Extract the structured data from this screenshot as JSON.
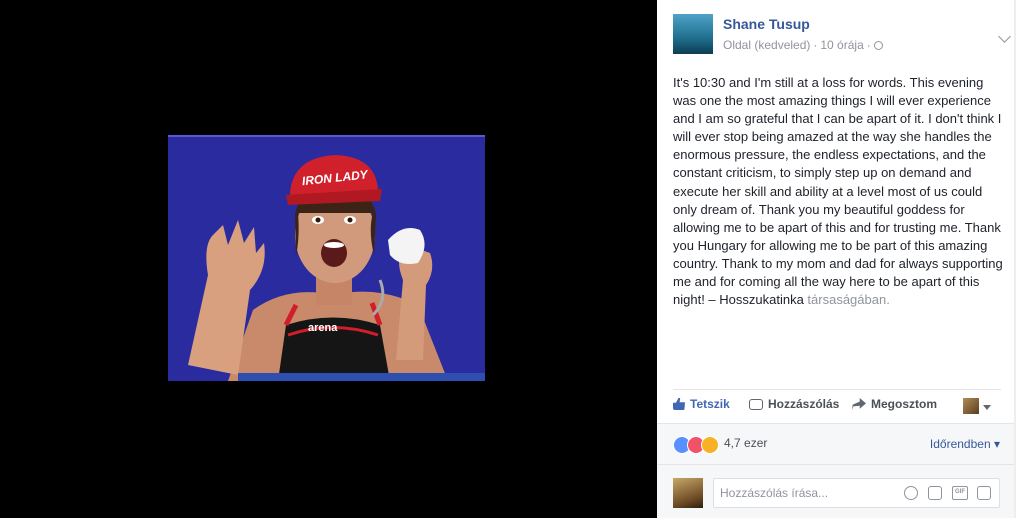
{
  "post": {
    "author": "Shane Tusup",
    "meta_type": "Oldal (kedveled)",
    "meta_time": "10 órája",
    "dot": "·",
    "text": "It's 10:30 and I'm still at a loss for words. This evening was one the most amazing things I will ever experience and I am so grateful that I can be apart of it. I don't think I will ever stop being amazed at the way she handles the enormous pressure, the endless expectations, and the constant criticism, to simply step up on demand and execute her skill and ability at a level most of us could only dream of. Thank you my beautiful goddess for allowing me to be apart of this and for trusting me. Thank you Hungary for allowing me to be part of this amazing country. Thank to my mom and dad for always supporting me and for coming all the way here to be apart of this night! – Hosszukatinka",
    "tag_text": "társaságában."
  },
  "photo": {
    "cap_text": "IRON LADY",
    "suit_text": "arena"
  },
  "actions": {
    "like": "Tetszik",
    "comment": "Hozzászólás",
    "share": "Megosztom"
  },
  "reactions": {
    "count": "4,7 ezer",
    "sort_label": "Időrendben"
  },
  "comment": {
    "placeholder": "Hozzászólás írása...",
    "gif_label": "GIF"
  },
  "colors": {
    "link": "#365899",
    "like_blue": "#4267b2",
    "photo_bg": "#2a2a9e"
  }
}
